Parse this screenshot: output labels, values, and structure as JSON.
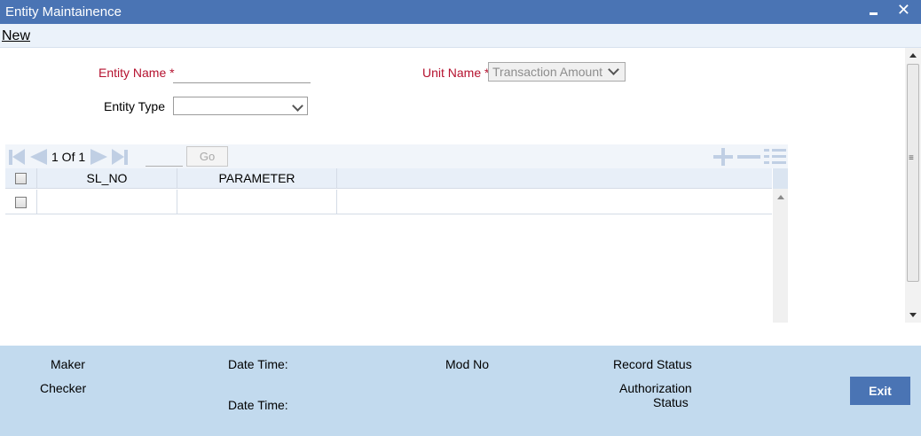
{
  "window": {
    "title": "Entity Maintainence",
    "minimize_label": "",
    "close_label": "✕"
  },
  "menubar": {
    "new_label": "New"
  },
  "form": {
    "entity_name": {
      "label": "Entity Name",
      "required_mark": "*",
      "value": ""
    },
    "unit_name": {
      "label": "Unit Name",
      "required_mark": "*",
      "selected": "Transaction Amount"
    },
    "entity_type": {
      "label": "Entity Type",
      "selected": ""
    }
  },
  "grid": {
    "pager": {
      "text": "1 Of 1",
      "goto_value": "",
      "go_label": "Go"
    },
    "columns": [
      "SL_NO",
      "PARAMETER"
    ],
    "rows": [
      {
        "sl_no": "",
        "parameter": ""
      }
    ]
  },
  "footer": {
    "maker_label": "Maker",
    "checker_label": "Checker",
    "date_time_label_1": "Date Time:",
    "date_time_label_2": "Date Time:",
    "mod_no_label": "Mod No",
    "record_status_label": "Record Status",
    "authorization_label": "Authorization",
    "status_label": "Status",
    "exit_label": "Exit"
  },
  "colors": {
    "title_bar": "#4a74b4",
    "required_label": "#b5122f",
    "footer_bg": "#c2daee",
    "toolbar_icons": "#c0cfe4"
  }
}
